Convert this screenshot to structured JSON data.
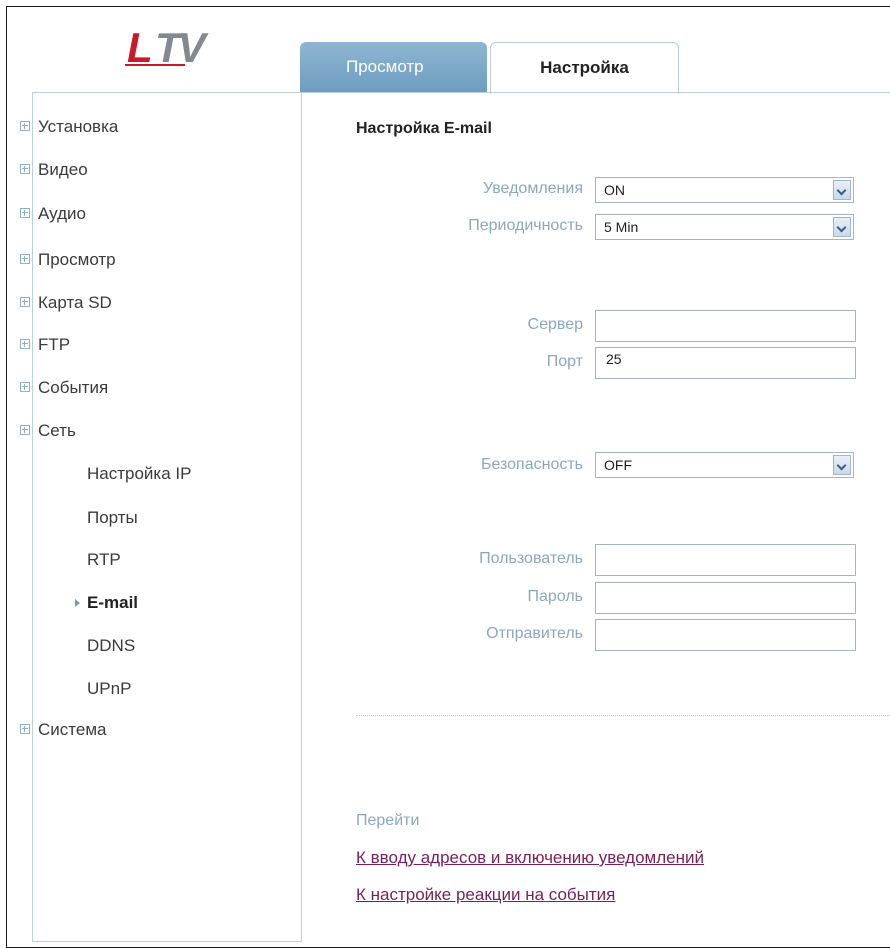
{
  "logo": {
    "text": "LTV",
    "colors": {
      "primary": "#c8182a",
      "secondary": "#7f8a93"
    }
  },
  "tabs": [
    {
      "label": "Просмотр",
      "active": false
    },
    {
      "label": "Настройка",
      "active": true
    }
  ],
  "sidebar": {
    "items": [
      {
        "label": "Установка"
      },
      {
        "label": "Видео"
      },
      {
        "label": "Аудио"
      },
      {
        "label": "Просмотр"
      },
      {
        "label": "Карта SD"
      },
      {
        "label": "FTP"
      },
      {
        "label": "События"
      },
      {
        "label": "Сеть"
      },
      {
        "label": "Система"
      }
    ],
    "subitems": [
      {
        "label": "Настройка IP",
        "active": false
      },
      {
        "label": "Порты",
        "active": false
      },
      {
        "label": "RTP",
        "active": false
      },
      {
        "label": "E-mail",
        "active": true
      },
      {
        "label": "DDNS",
        "active": false
      },
      {
        "label": "UPnP",
        "active": false
      }
    ]
  },
  "main": {
    "title": "Настройка E-mail",
    "notifications": {
      "label": "Уведомления",
      "value": "ON"
    },
    "period": {
      "label": "Периодичность",
      "value": "5 Min"
    },
    "server": {
      "label": "Сервер",
      "value": ""
    },
    "port": {
      "label": "Порт",
      "value": "25"
    },
    "security": {
      "label": "Безопасность",
      "value": "OFF"
    },
    "user": {
      "label": "Пользователь",
      "value": ""
    },
    "password": {
      "label": "Пароль",
      "value": ""
    },
    "sender": {
      "label": "Отправитель",
      "value": ""
    },
    "goto_label": "Перейти",
    "links": [
      {
        "label": "К вводу адресов и включению уведомлений"
      },
      {
        "label": "К настройке реакции на события"
      }
    ]
  },
  "colors": {
    "accent": "#6d9dc0",
    "label": "#8aa8bf",
    "link": "#7a1f5e"
  }
}
